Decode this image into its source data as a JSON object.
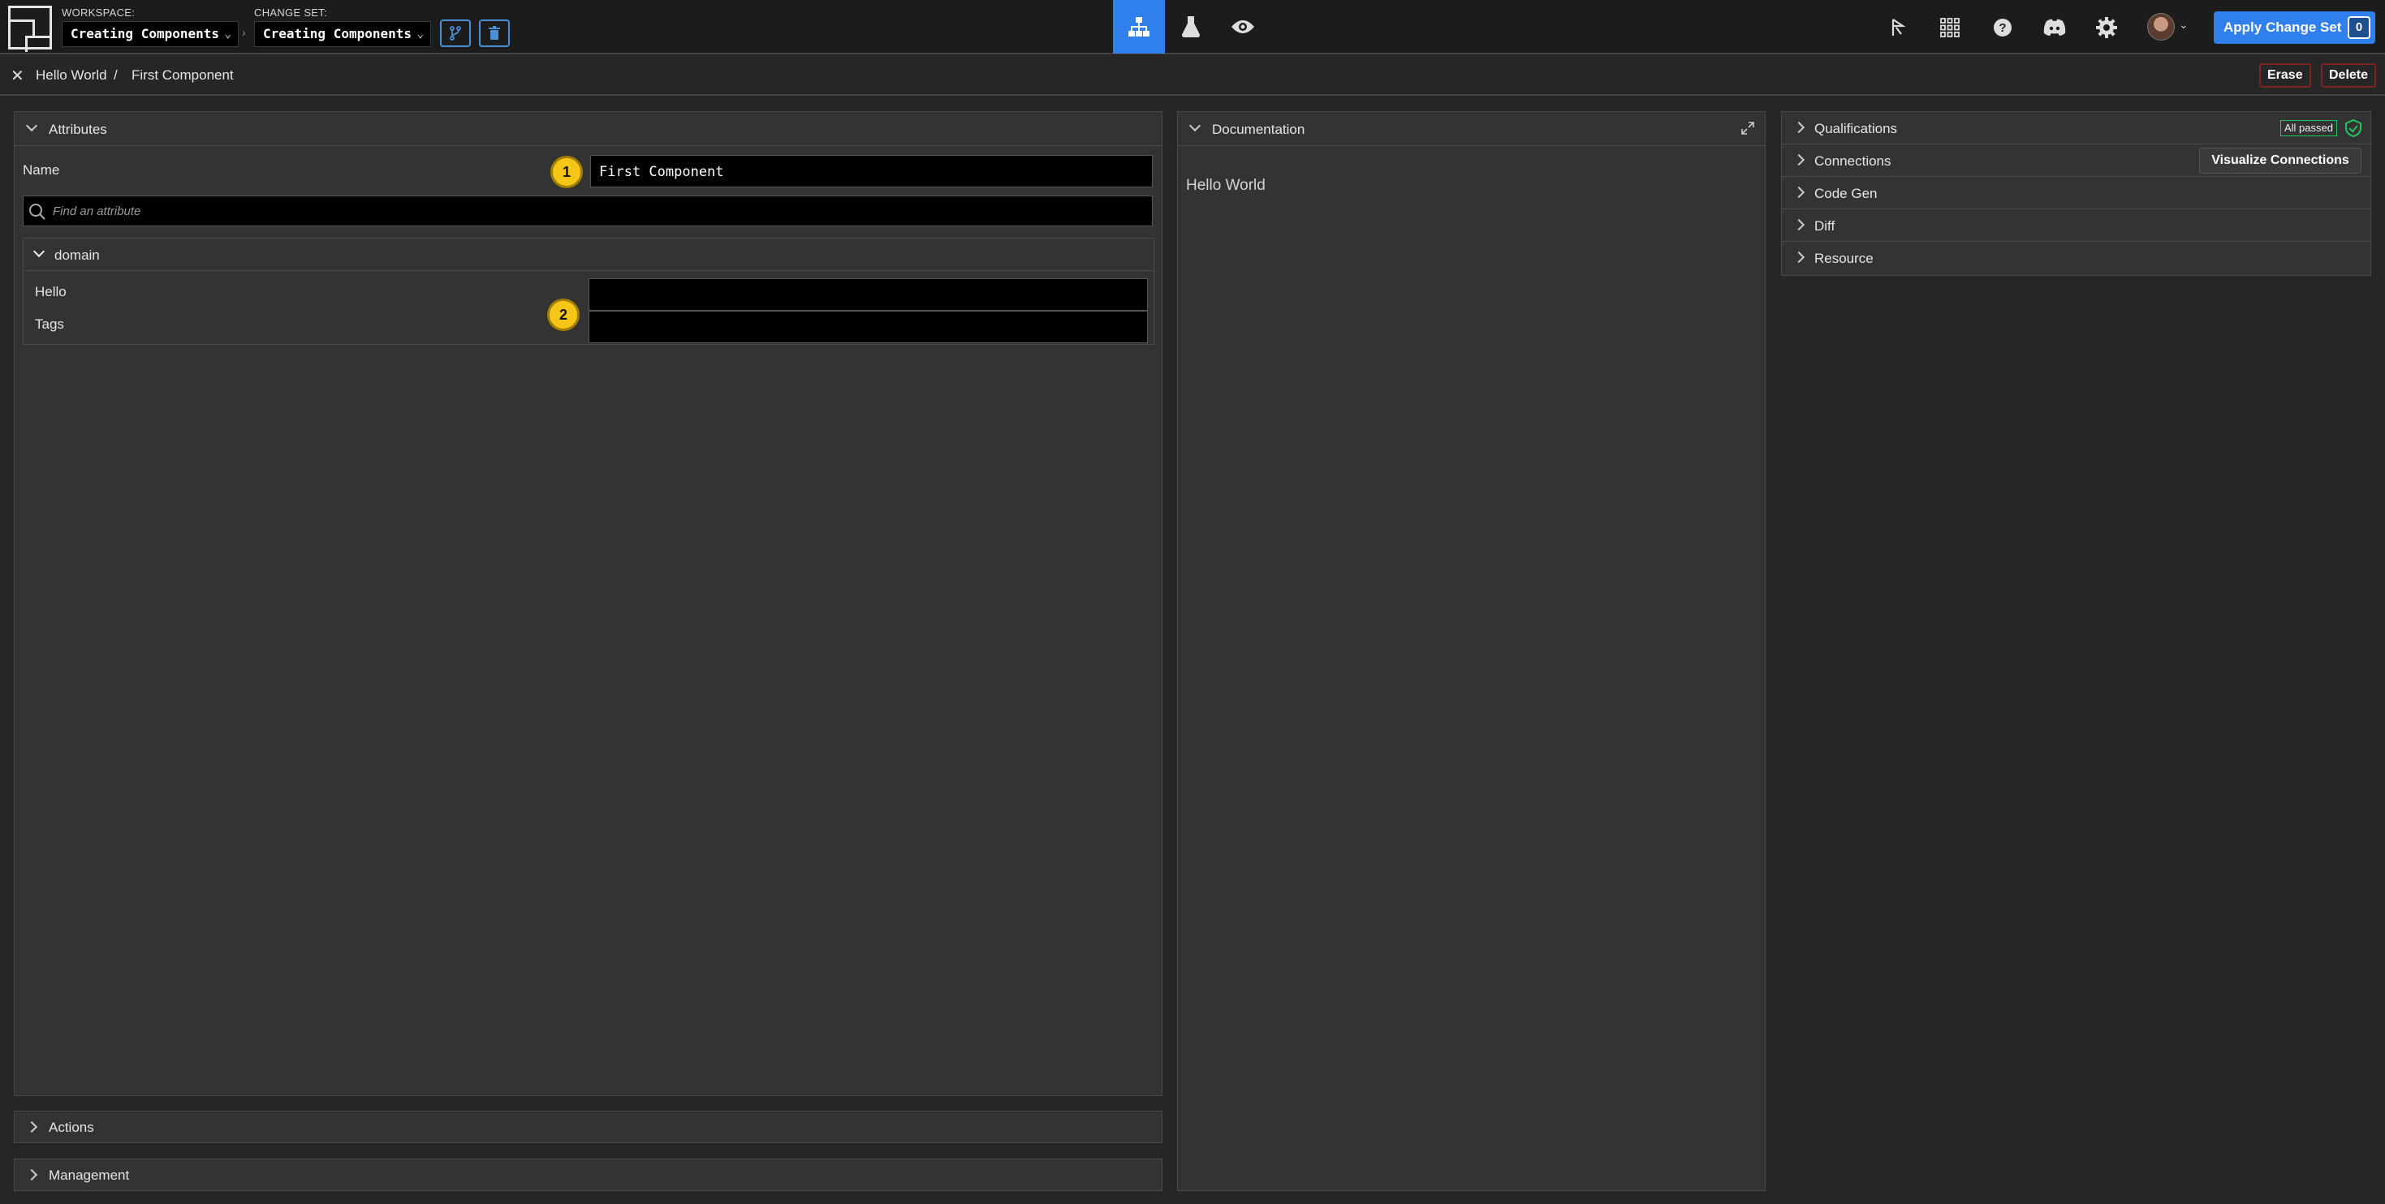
{
  "topbar": {
    "workspace_label": "WORKSPACE:",
    "workspace_value": "Creating Components",
    "changeset_label": "CHANGE SET:",
    "changeset_value": "Creating Components",
    "apply_label": "Apply Change Set",
    "apply_count": "0",
    "accent": "#2f80ed",
    "icons": [
      "merge-icon",
      "trash-icon",
      "diagram-icon",
      "flask-icon",
      "eye-icon",
      "cursor-icon",
      "grid-icon",
      "help-icon",
      "discord-icon",
      "gear-icon",
      "avatar",
      "chevron-down-icon"
    ]
  },
  "breadcrumb": {
    "parent": "Hello World",
    "separator": "/",
    "current": "First Component",
    "erase_label": "Erase",
    "delete_label": "Delete"
  },
  "attributes": {
    "title": "Attributes",
    "name_label": "Name",
    "name_value": "First Component",
    "badge_1": "1",
    "search_placeholder": "Find an attribute",
    "group_title": "domain",
    "hello_label": "Hello",
    "tags_label": "Tags",
    "badge_2": "2"
  },
  "bottom_sections": {
    "actions": "Actions",
    "management": "Management"
  },
  "documentation": {
    "title": "Documentation",
    "body": "Hello World"
  },
  "right_panel": {
    "qualifications": "Qualifications",
    "qual_status": "All passed",
    "connections": "Connections",
    "visualize_label": "Visualize Connections",
    "codegen": "Code Gen",
    "diff": "Diff",
    "resource": "Resource",
    "success_color": "#22c55e"
  }
}
